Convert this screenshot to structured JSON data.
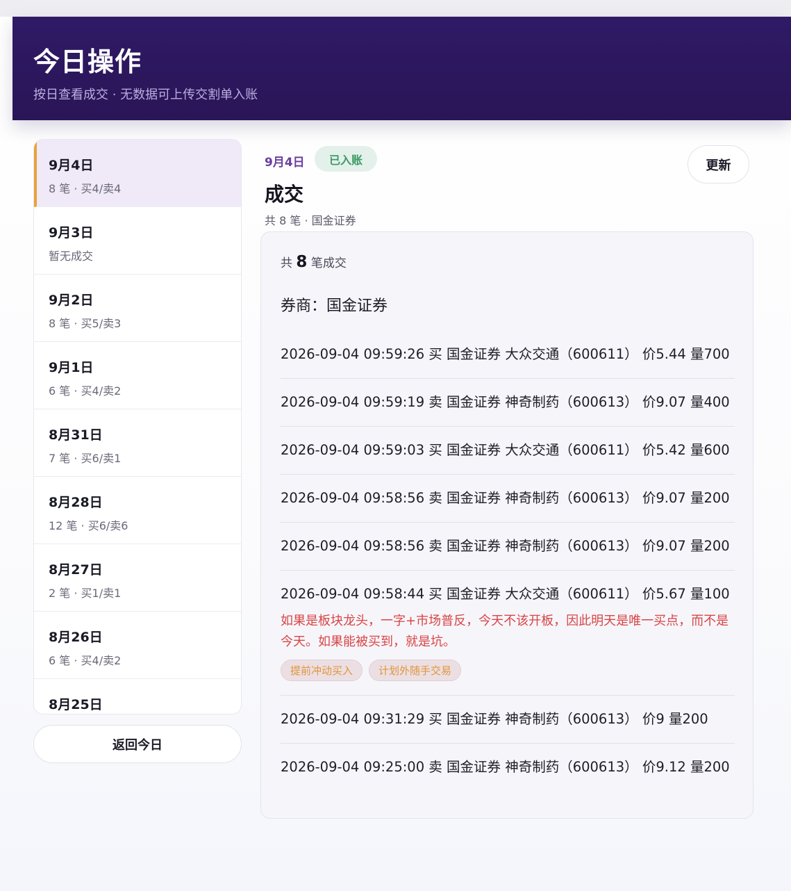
{
  "header": {
    "title": "今日操作",
    "subtitle": "按日查看成交 · 无数据可上传交割单入账"
  },
  "dates": [
    {
      "label": "9月4日",
      "summary": "8 笔 · 买4/卖4",
      "active": true
    },
    {
      "label": "9月3日",
      "summary": "暂无成交"
    },
    {
      "label": "9月2日",
      "summary": "8 笔 · 买5/卖3"
    },
    {
      "label": "9月1日",
      "summary": "6 笔 · 买4/卖2"
    },
    {
      "label": "8月31日",
      "summary": "7 笔 · 买6/卖1"
    },
    {
      "label": "8月28日",
      "summary": "12 笔 · 买6/卖6"
    },
    {
      "label": "8月27日",
      "summary": "2 笔 · 买1/卖1"
    },
    {
      "label": "8月26日",
      "summary": "6 笔 · 买4/卖2"
    },
    {
      "label": "8月25日",
      "summary": ""
    }
  ],
  "back_button": "返回今日",
  "detail": {
    "date": "9月4日",
    "status_badge": "已入账",
    "refresh_button": "更新",
    "section_title": "成交",
    "meta": "共 8 笔 · 国金证券",
    "count_prefix": "共",
    "count_value": "8",
    "count_suffix": "笔成交",
    "broker": "券商：国金证券",
    "trades": [
      {
        "line": "2026-09-04 09:59:26 买 国金证券 大众交通（600611） 价5.44 量700"
      },
      {
        "line": "2026-09-04 09:59:19 卖 国金证券 神奇制药（600613） 价9.07 量400"
      },
      {
        "line": "2026-09-04 09:59:03 买 国金证券 大众交通（600611） 价5.42 量600"
      },
      {
        "line": "2026-09-04 09:58:56 卖 国金证券 神奇制药（600613） 价9.07 量200"
      },
      {
        "line": "2026-09-04 09:58:56 卖 国金证券 神奇制药（600613） 价9.07 量200"
      },
      {
        "line": "2026-09-04 09:58:44 买 国金证券 大众交通（600611） 价5.67 量100",
        "note": "如果是板块龙头，一字+市场普反，今天不该开板，因此明天是唯一买点，而不是今天。如果能被买到，就是坑。",
        "tags": [
          "提前冲动买入",
          "计划外随手交易"
        ]
      },
      {
        "line": "2026-09-04 09:31:29 买 国金证券 神奇制药（600613） 价9 量200"
      },
      {
        "line": "2026-09-04 09:25:00 卖 国金证券 神奇制药（600613） 价9.12 量200"
      }
    ]
  },
  "colors": {
    "header_bg": "#2f1a66",
    "accent_purple": "#6a3fa0",
    "active_marker": "#e8a23d",
    "badge_green": "#3e9a68",
    "note_red": "#d84545",
    "tag_text": "#e0953a"
  }
}
